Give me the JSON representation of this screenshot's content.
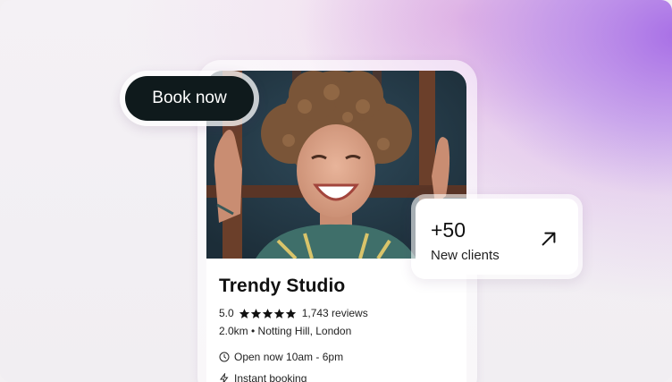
{
  "actions": {
    "book_label": "Book now"
  },
  "listing": {
    "name": "Trendy Studio",
    "rating": "5.0",
    "stars_count": 5,
    "reviews": "1,743 reviews",
    "location": "2.0km • Notting Hill, London",
    "hours": "Open now 10am - 6pm",
    "booking": "Instant booking",
    "icons": {
      "hours": "clock-icon",
      "booking": "lightning-icon",
      "stats": "arrow-up-right-icon"
    }
  },
  "stats": {
    "value": "+50",
    "label": "New clients"
  },
  "colors": {
    "button": "#0f1a1c",
    "accent": "#a86fe6",
    "text": "#111111"
  }
}
